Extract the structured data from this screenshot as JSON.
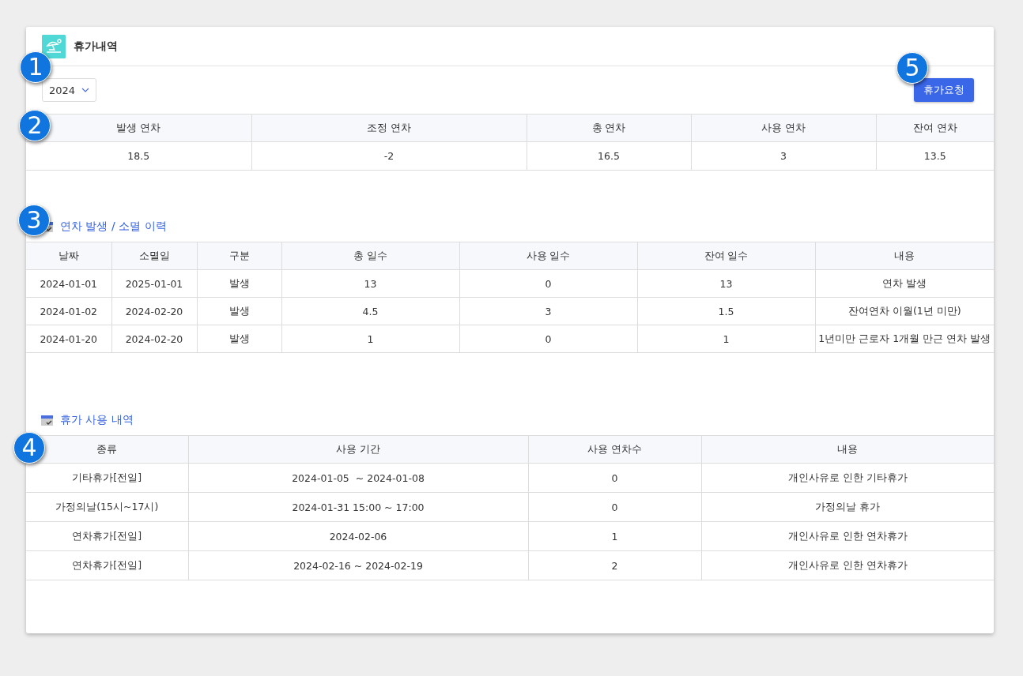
{
  "header": {
    "title": "휴가내역"
  },
  "year_select": {
    "value": "2024"
  },
  "request_button": "휴가요청",
  "summary": {
    "columns": [
      "발생 연차",
      "조정 연차",
      "총 연차",
      "사용 연차",
      "잔여 연차"
    ],
    "rows": [
      [
        "18.5",
        "-2",
        "16.5",
        "3",
        "13.5"
      ]
    ]
  },
  "history": {
    "title": "연차 발생 / 소멸 이력",
    "columns": [
      "날짜",
      "소멸일",
      "구분",
      "총 일수",
      "사용 일수",
      "잔여 일수",
      "내용"
    ],
    "rows": [
      [
        "2024-01-01",
        "2025-01-01",
        "발생",
        "13",
        "0",
        "13",
        "연차 발생"
      ],
      [
        "2024-01-02",
        "2024-02-20",
        "발생",
        "4.5",
        "3",
        "1.5",
        "잔여연차 이월(1년 미만)"
      ],
      [
        "2024-01-20",
        "2024-02-20",
        "발생",
        "1",
        "0",
        "1",
        "1년미만 근로자 1개월 만근 연차 발생"
      ]
    ]
  },
  "usage": {
    "title": "휴가 사용 내역",
    "columns": [
      "종류",
      "사용 기간",
      "사용 연차수",
      "내용"
    ],
    "rows": [
      [
        "기타휴가[전일]",
        "2024-01-05  ~ 2024-01-08",
        "0",
        "개인사유로 인한 기타휴가"
      ],
      [
        "가정의날(15시~17시)",
        "2024-01-31 15:00 ~ 17:00",
        "0",
        "가정의날 휴가"
      ],
      [
        "연차휴가[전일]",
        "2024-02-06",
        "1",
        "개인사유로 인한 연차휴가"
      ],
      [
        "연차휴가[전일]",
        "2024-02-16 ~ 2024-02-19",
        "2",
        "개인사유로 인한 연차휴가"
      ]
    ]
  },
  "markers": [
    "1",
    "2",
    "3",
    "4",
    "5"
  ]
}
